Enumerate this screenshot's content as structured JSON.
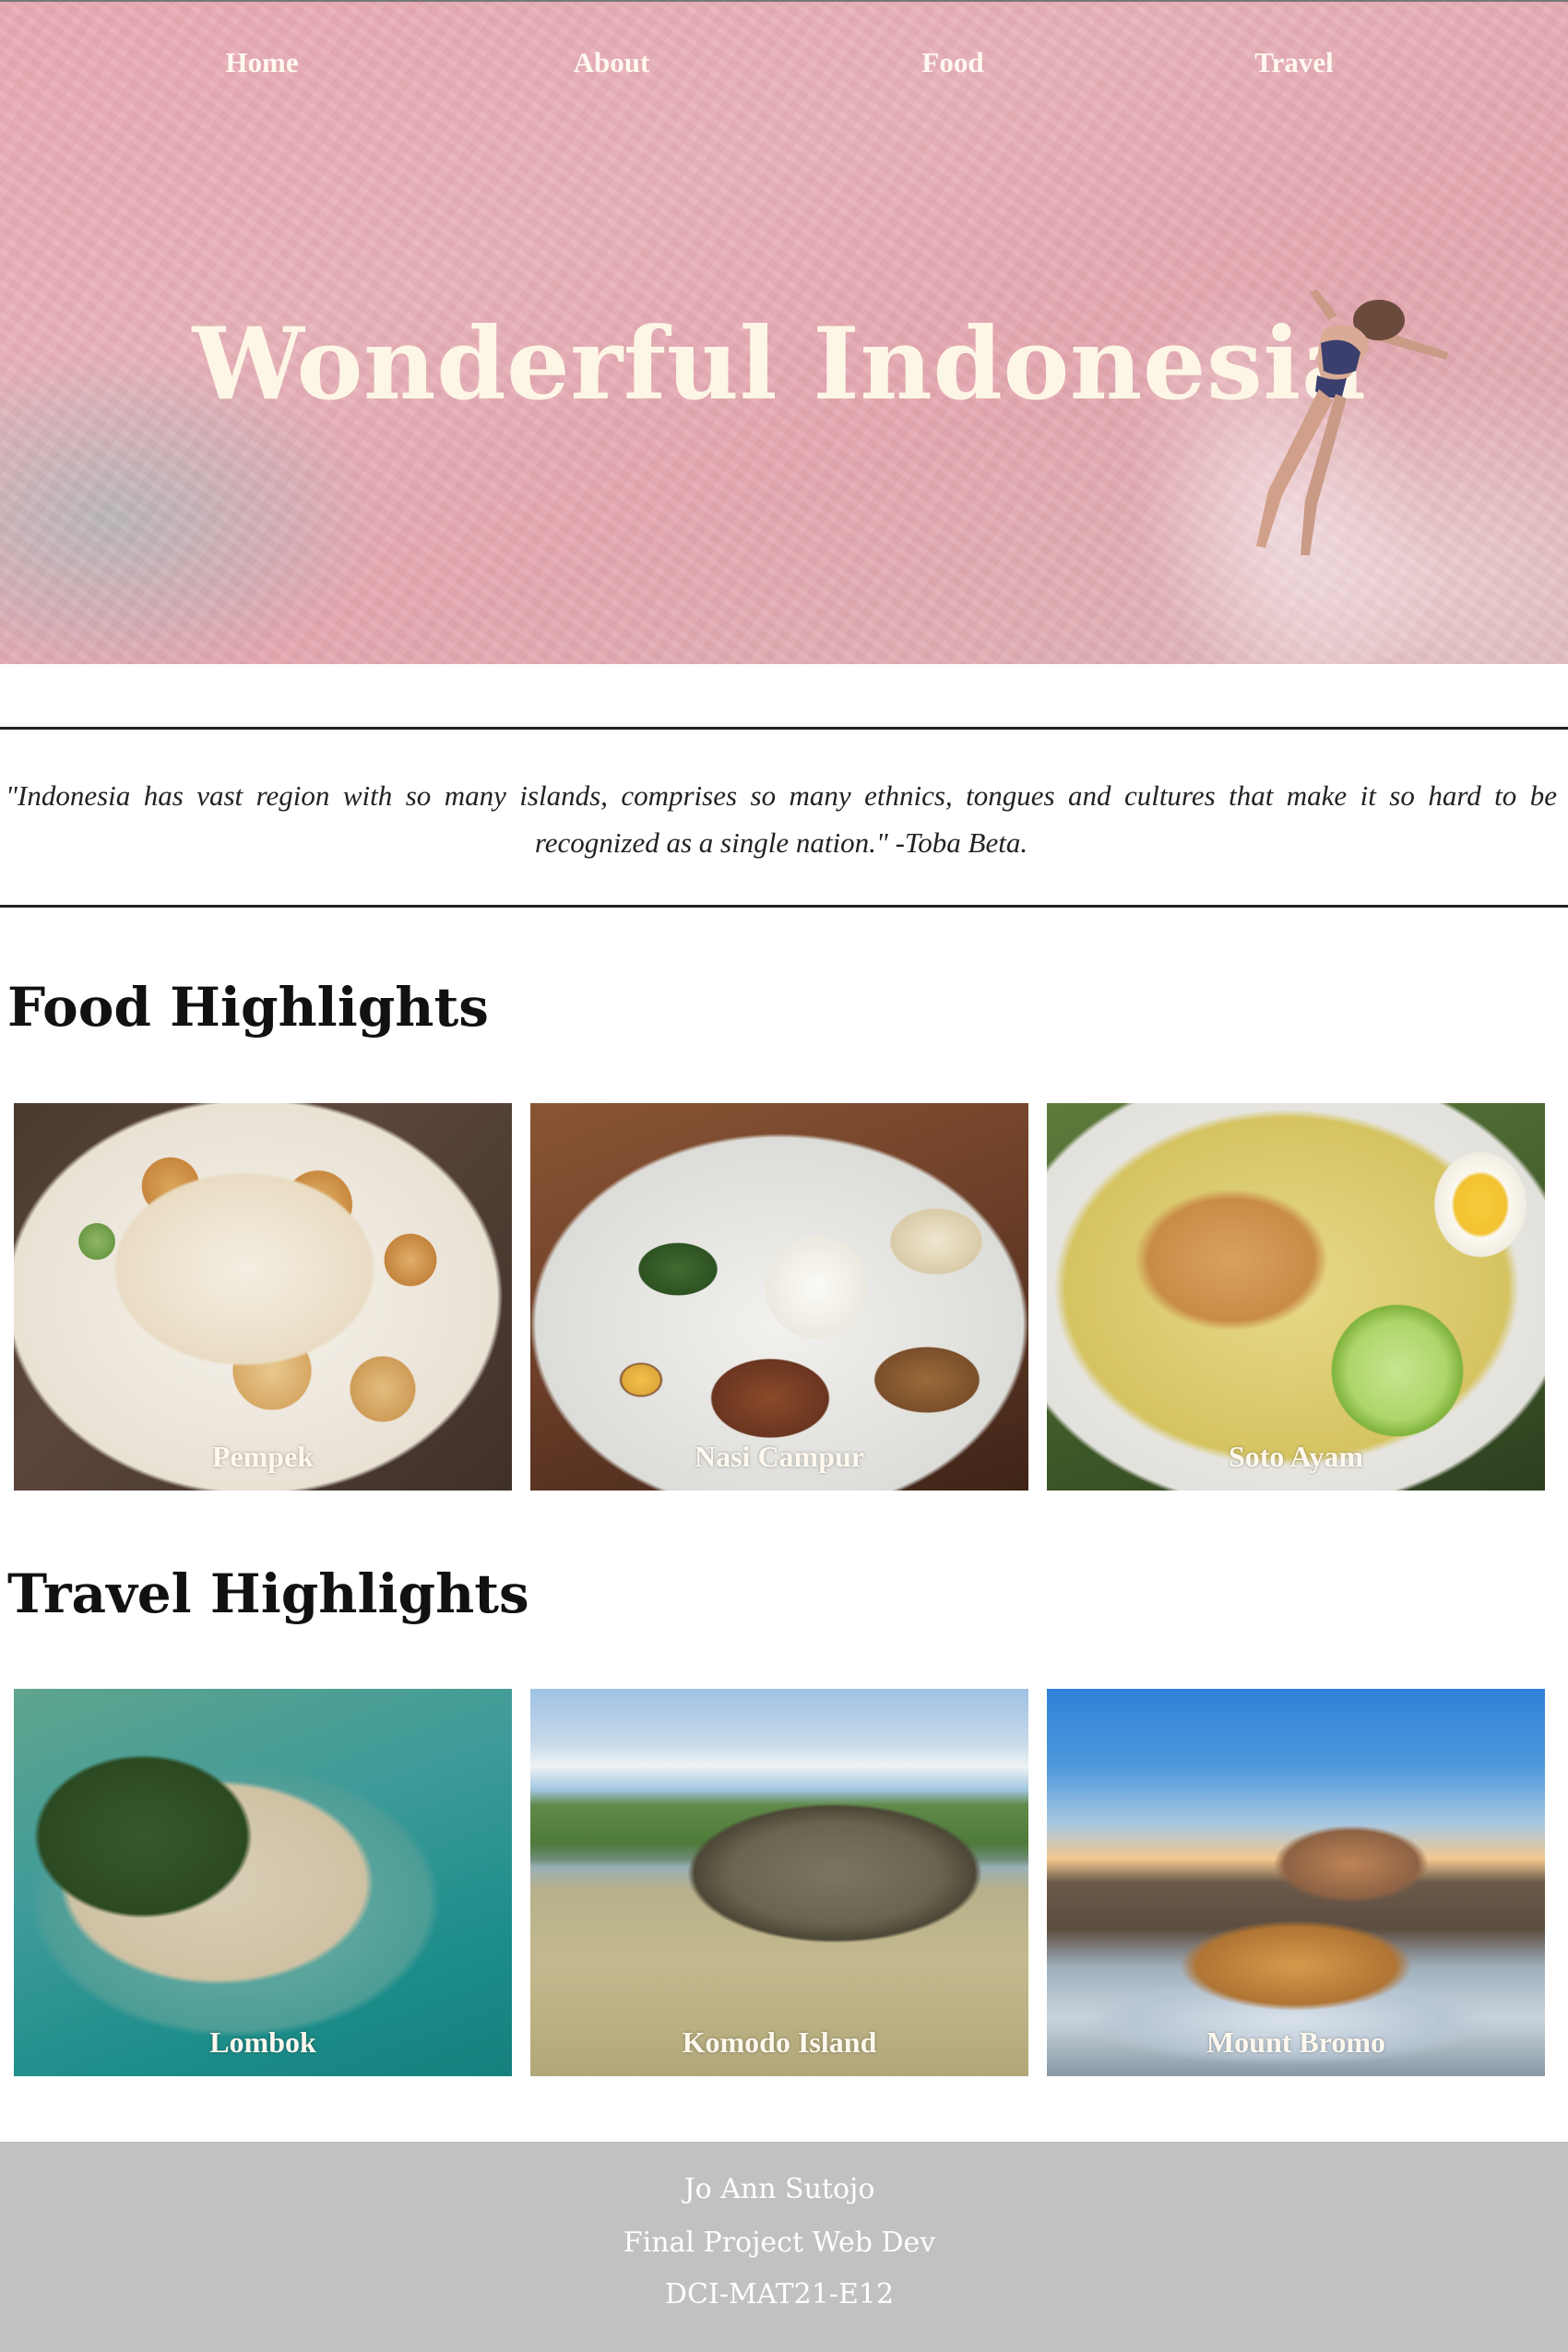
{
  "nav": {
    "home": "Home",
    "about": "About",
    "food": "Food",
    "travel": "Travel"
  },
  "hero": {
    "title": "Wonderful Indonesia",
    "background_colors": [
      "#e9a9b3",
      "#ddb3b6"
    ]
  },
  "quote": {
    "text": "\"Indonesia has vast region with so many islands, comprises so many ethnics, tongues and cultures that make it so hard to be recognized as a single nation.\" -Toba Beta."
  },
  "food_section": {
    "title": "Food Highlights",
    "items": [
      {
        "label": "Pempek"
      },
      {
        "label": "Nasi Campur"
      },
      {
        "label": "Soto Ayam"
      }
    ]
  },
  "travel_section": {
    "title": "Travel Highlights",
    "items": [
      {
        "label": "Lombok"
      },
      {
        "label": "Komodo Island"
      },
      {
        "label": "Mount Bromo"
      }
    ]
  },
  "footer": {
    "line1": "Jo Ann Sutojo",
    "line2": "Final Project Web Dev",
    "line3": "DCI-MAT21-E12",
    "background": "#c1c1c1"
  }
}
